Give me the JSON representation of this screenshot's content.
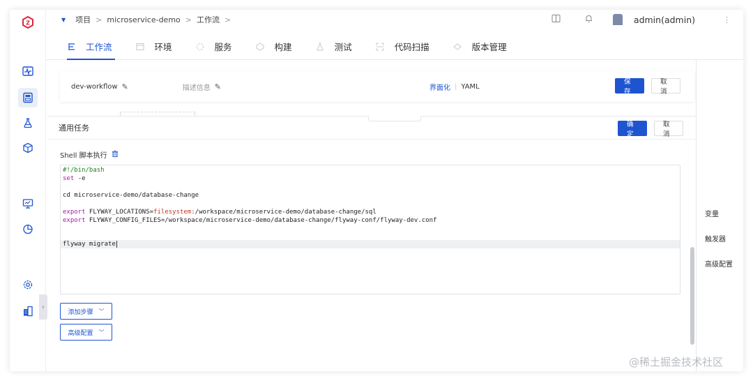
{
  "colors": {
    "accent": "#1f54d1",
    "brand_logo": "#e0263a"
  },
  "breadcrumb": {
    "items": [
      "项目",
      "microservice-demo",
      "工作流"
    ],
    "separator": ">"
  },
  "user": {
    "name": "admin(admin)"
  },
  "header_icons": [
    "book-icon",
    "bell-icon",
    "more-icon"
  ],
  "rail_icons": [
    "logo-icon",
    "pulse-icon",
    "pipeline-icon",
    "flask-icon",
    "package-icon",
    "monitor-icon",
    "pie-chart-icon",
    "settings-icon",
    "building-icon"
  ],
  "tabs": [
    {
      "label": "工作流",
      "icon": "workflow-icon",
      "active": true
    },
    {
      "label": "环境",
      "icon": "environment-icon",
      "active": false
    },
    {
      "label": "服务",
      "icon": "service-icon",
      "active": false
    },
    {
      "label": "构建",
      "icon": "build-icon",
      "active": false
    },
    {
      "label": "测试",
      "icon": "test-icon",
      "active": false
    },
    {
      "label": "代码扫描",
      "icon": "scan-icon",
      "active": false
    },
    {
      "label": "版本管理",
      "icon": "version-icon",
      "active": false
    }
  ],
  "workflow": {
    "name": "dev-workflow",
    "description_placeholder": "描述信息",
    "mode_gui": "界面化",
    "mode_yaml": "YAML",
    "save_label": "保存",
    "cancel_label": "取消"
  },
  "side_panel": {
    "items": [
      "变量",
      "触发器",
      "高级配置"
    ]
  },
  "task": {
    "title": "通用任务",
    "confirm_label": "确定",
    "cancel_label": "取消",
    "step_title": "Shell 脚本执行",
    "script_lines": [
      "#!/bin/bash",
      "set -e",
      "",
      "cd microservice-demo/database-change",
      "",
      "export FLYWAY_LOCATIONS=filesystem:/workspace/microservice-demo/database-change/sql",
      "export FLYWAY_CONFIG_FILES=/workspace/microservice-demo/database-change/flyway-conf/flyway-dev.conf",
      "",
      "",
      "flyway migrate"
    ],
    "add_step_label": "添加步骤",
    "advanced_label": "高级配置"
  },
  "watermark": "@稀土掘金技术社区"
}
